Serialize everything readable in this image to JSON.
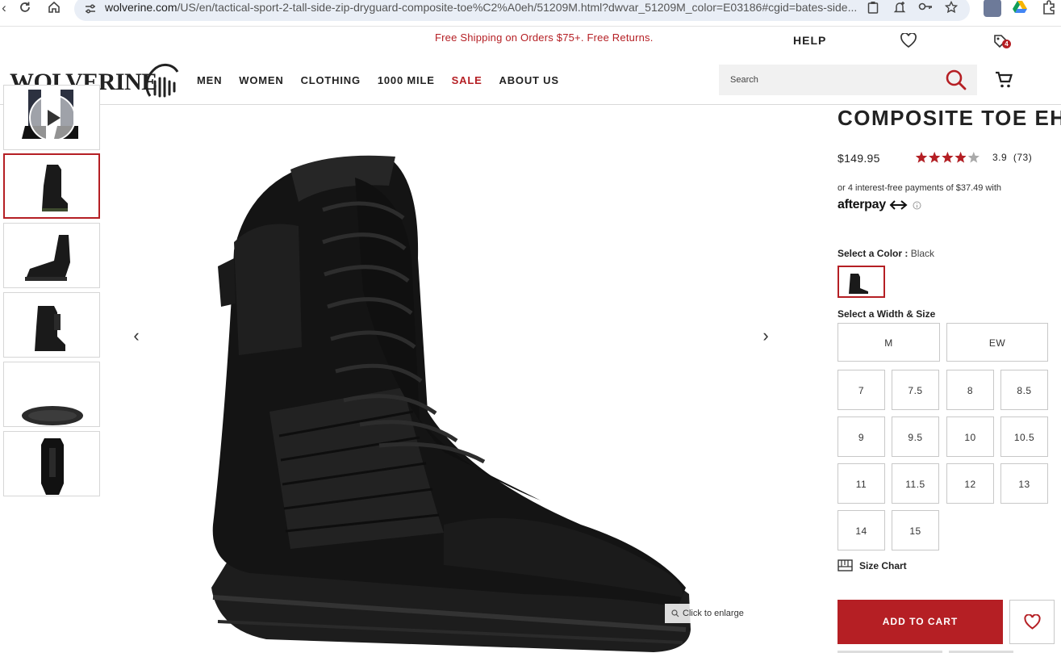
{
  "browser": {
    "url_host": "wolverine.com",
    "url_path": "/US/en/tactical-sport-2-tall-side-zip-dryguard-composite-toe%C2%A0eh/51209M.html?dwvar_51209M_color=E03186#cgid=bates-side..."
  },
  "header": {
    "promo": "Free Shipping on Orders $75+. Free Returns.",
    "help": "HELP",
    "store_badge": "4",
    "logo": "WOLVERINE",
    "nav": [
      "MEN",
      "WOMEN",
      "CLOTHING",
      "1000 MILE",
      "SALE",
      "ABOUT US"
    ],
    "search_placeholder": "Search"
  },
  "gallery": {
    "enlarge_label": "Click to enlarge"
  },
  "product": {
    "title": "COMPOSITE TOE EH",
    "price": "$149.95",
    "rating_value": "3.9",
    "rating_count": "(73)",
    "rating_stars": 3.9,
    "installments": "or 4 interest-free payments of $37.49 with",
    "afterpay": "afterpay",
    "color_label": "Select a Color :",
    "color_value": "Black",
    "size_label": "Select a Width & Size",
    "widths": [
      "M",
      "EW"
    ],
    "sizes": [
      "7",
      "7.5",
      "8",
      "8.5",
      "9",
      "9.5",
      "10",
      "10.5",
      "11",
      "11.5",
      "12",
      "13",
      "14",
      "15"
    ],
    "size_chart": "Size Chart",
    "add_to_cart": "ADD TO CART"
  },
  "colors": {
    "accent": "#b51f24",
    "text": "#222222",
    "border": "#c8c8c8"
  }
}
